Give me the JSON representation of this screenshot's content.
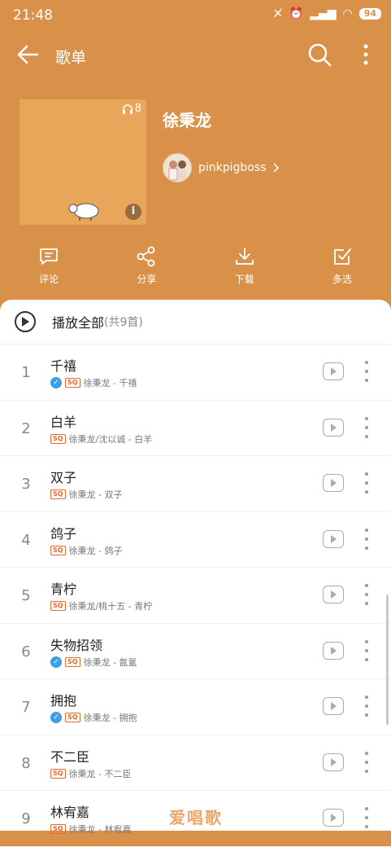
{
  "status": {
    "time": "21:48",
    "battery": "94"
  },
  "header": {
    "title": "歌单"
  },
  "playlist": {
    "name": "徐秉龙",
    "listen_count": "8",
    "owner": "pinkpigboss"
  },
  "actions": [
    {
      "label": "评论",
      "icon": "comment-icon"
    },
    {
      "label": "分享",
      "icon": "share-icon"
    },
    {
      "label": "下载",
      "icon": "download-icon"
    },
    {
      "label": "多选",
      "icon": "multi-select-icon"
    }
  ],
  "playall": {
    "label": "播放全部",
    "count": "(共9首)"
  },
  "songs": [
    {
      "num": "1",
      "title": "千禧",
      "sub": "徐秉龙 - 千禧",
      "verified": true
    },
    {
      "num": "2",
      "title": "白羊",
      "sub": "徐秉龙/沈以诚 - 白羊",
      "verified": false
    },
    {
      "num": "3",
      "title": "双子",
      "sub": "徐秉龙 - 双子",
      "verified": false
    },
    {
      "num": "4",
      "title": "鸽子",
      "sub": "徐秉龙 - 鸽子",
      "verified": false
    },
    {
      "num": "5",
      "title": "青柠",
      "sub": "徐秉龙/桃十五 - 青柠",
      "verified": false
    },
    {
      "num": "6",
      "title": "失物招领",
      "sub": "徐秉龙 - 氤氲",
      "verified": true
    },
    {
      "num": "7",
      "title": "拥抱",
      "sub": "徐秉龙 - 拥抱",
      "verified": true
    },
    {
      "num": "8",
      "title": "不二臣",
      "sub": "徐秉龙 - 不二臣",
      "verified": false
    },
    {
      "num": "9",
      "title": "林宥嘉",
      "sub": "徐秉龙 - 林宥嘉",
      "verified": false
    }
  ],
  "quality_badge": "SQ",
  "watermark": "爱唱歌",
  "colors": {
    "theme": "#d9914a",
    "accent": "#e26a2c",
    "verified": "#3e9ee6"
  }
}
